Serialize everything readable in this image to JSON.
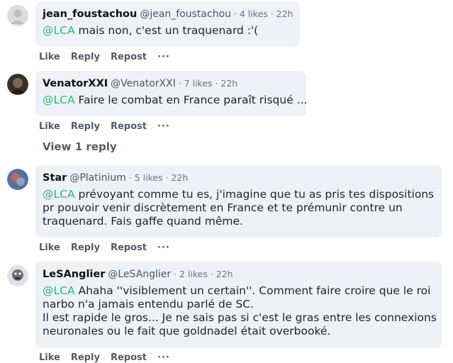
{
  "comments": [
    {
      "author": "jean_foustachou",
      "handle": "@jean_foustachou",
      "likes": "4 likes",
      "time": "22h",
      "mention": "@LCA",
      "lines": [
        "mais non, c'est un traquenard :'("
      ]
    },
    {
      "author": "VenatorXXI",
      "handle": "@VenatorXXI",
      "likes": "7 likes",
      "time": "22h",
      "mention": "@LCA",
      "lines": [
        "Faire le combat en France paraît risqué ..."
      ]
    },
    {
      "author": "Star",
      "handle": "@Platinium",
      "likes": "5 likes",
      "time": "22h",
      "mention": "@LCA",
      "lines": [
        "prévoyant comme tu es, j'imagine que tu as pris tes dispositions",
        "pr pouvoir venir discrètement en France et te prémunir contre un",
        "traquenard. Fais gaffe quand même."
      ]
    },
    {
      "author": "LeSAnglier",
      "handle": "@LeSAnglier",
      "likes": "2 likes",
      "time": "22h",
      "mention": "@LCA",
      "lines": [
        "Ahaha ''visiblement un certain''. Comment faire croire que le roi",
        "narbo n'a jamais entendu parlé de SC.",
        "Il est rapide le gros... Je ne sais pas si c'est le gras entre les connexions",
        "neuronales ou le fait que goldnadel était overbooké."
      ]
    }
  ],
  "actions": {
    "like": "Like",
    "reply": "Reply",
    "repost": "Repost",
    "more": "···"
  },
  "view_reply": "View 1 reply"
}
